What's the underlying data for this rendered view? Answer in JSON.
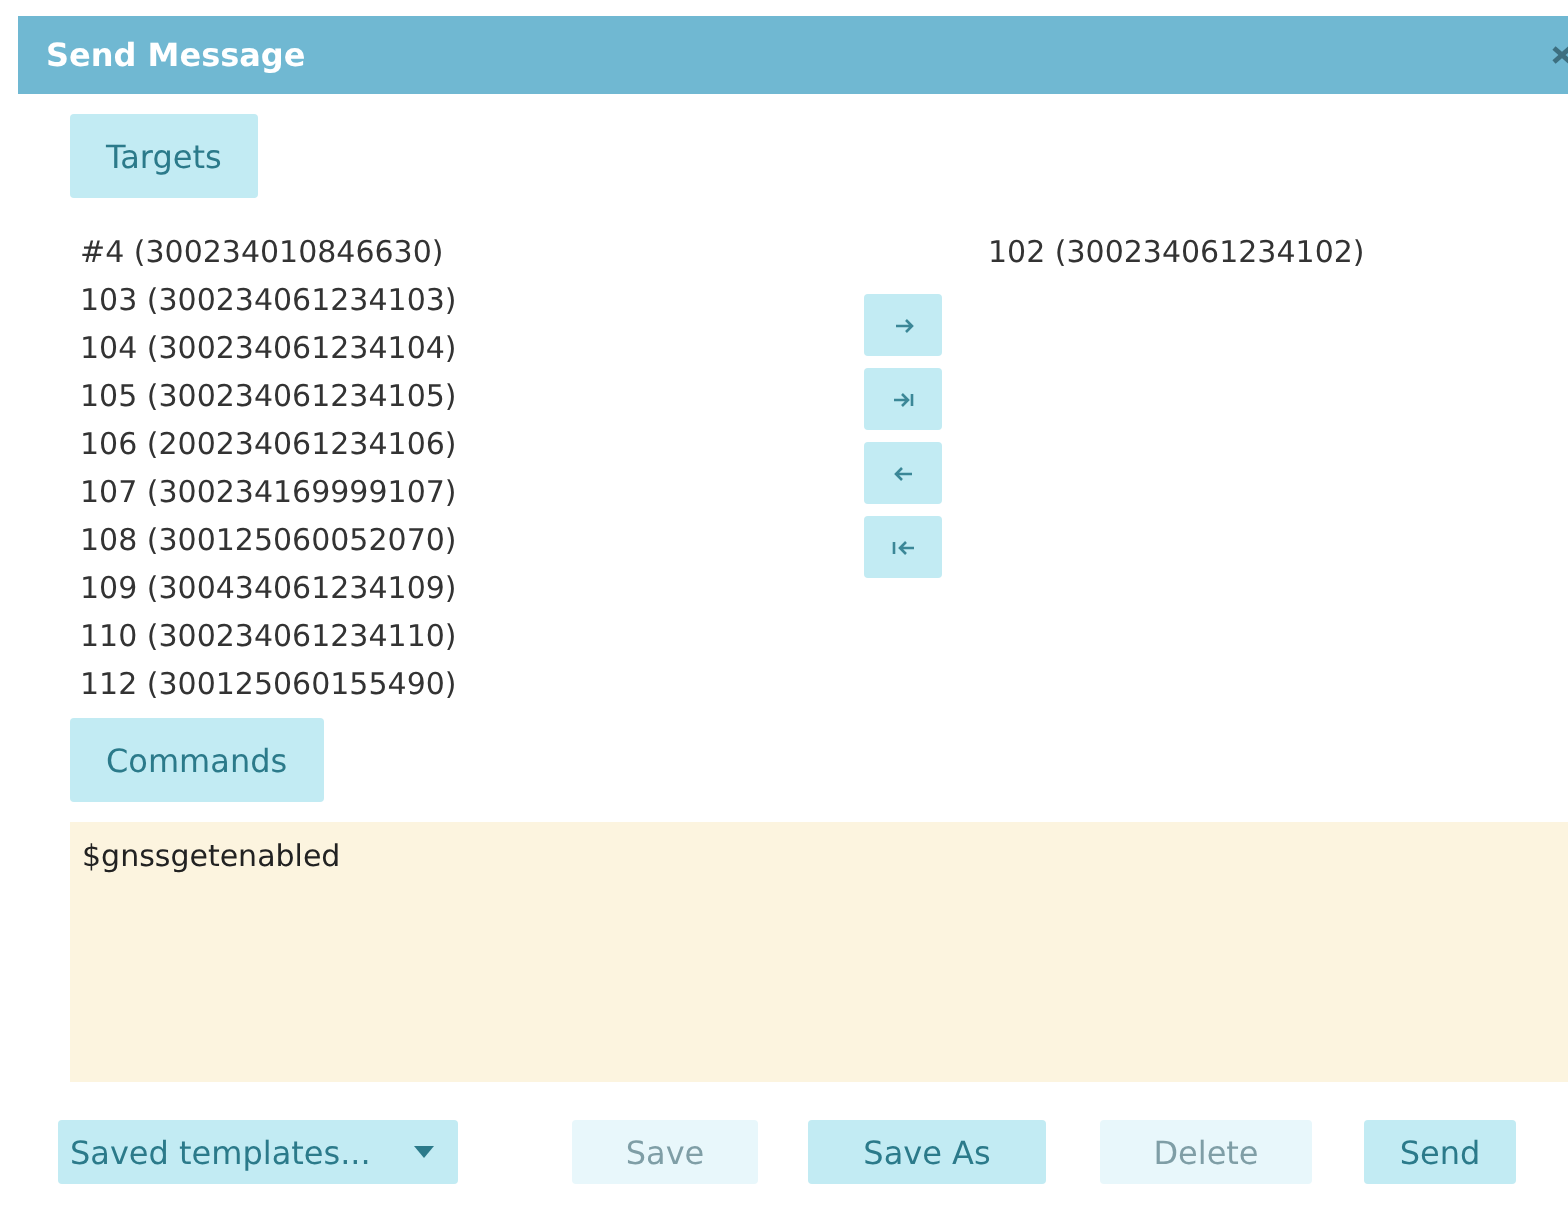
{
  "window": {
    "title": "Send Message"
  },
  "targets": {
    "label": "Targets",
    "available": [
      "#4 (300234010846630)",
      "103 (300234061234103)",
      "104 (300234061234104)",
      "105 (300234061234105)",
      "106 (200234061234106)",
      "107 (300234169999107)",
      "108 (300125060052070)",
      "109 (300434061234109)",
      "110 (300234061234110)",
      "112 (300125060155490)"
    ],
    "transfer": [
      {
        "kind": "move"
      },
      {
        "kind": "move-all"
      },
      {
        "kind": "remove"
      },
      {
        "kind": "remove-all"
      }
    ],
    "chosen": [
      "102 (300234061234102)"
    ]
  },
  "commands": {
    "label": "Commands",
    "value": "$gnssgetenabled"
  },
  "footer": {
    "templates": "Saved templates...",
    "buttons": [
      {
        "label": "Save",
        "disabled": true
      },
      {
        "label": "Save As",
        "disabled": false
      },
      {
        "label": "Delete",
        "disabled": true
      },
      {
        "label": "Send",
        "disabled": false
      }
    ]
  }
}
